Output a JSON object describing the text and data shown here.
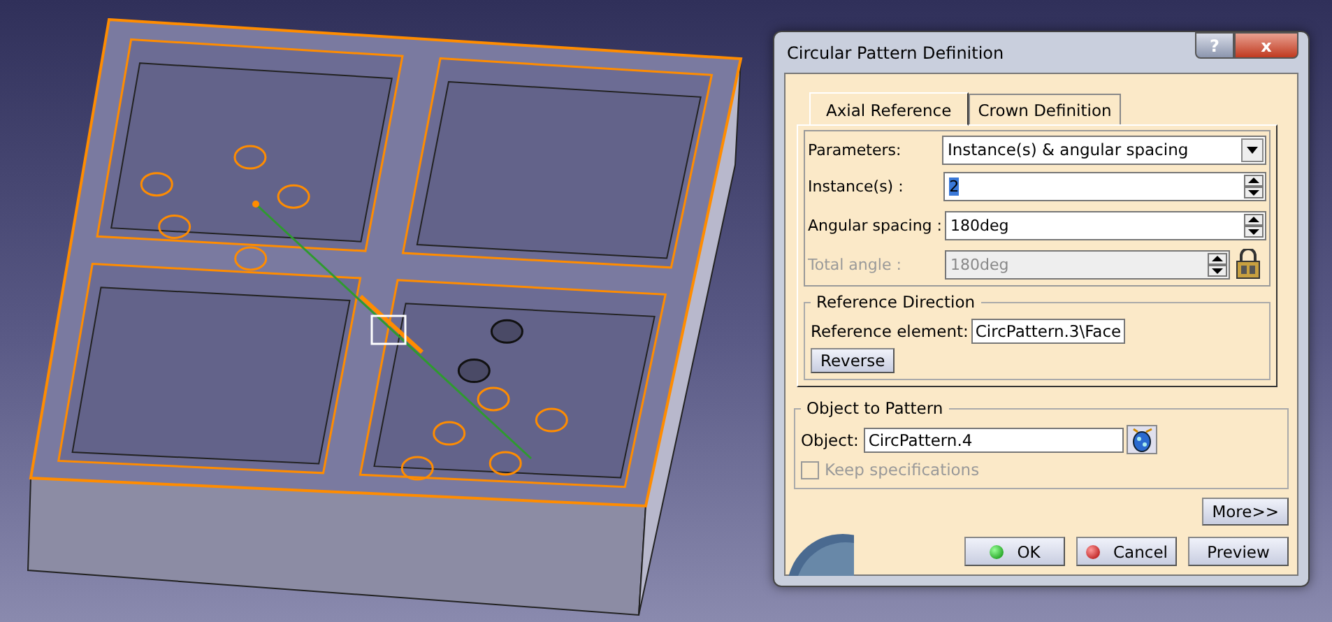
{
  "dialog": {
    "title": "Circular Pattern Definition",
    "help": "?",
    "close": "x"
  },
  "tabs": [
    {
      "label": "Axial Reference",
      "selected": true
    },
    {
      "label": "Crown Definition",
      "selected": false
    }
  ],
  "parameters": [
    {
      "kind": "select",
      "label": "Parameters:",
      "value": "Instance(s) & angular spacing"
    },
    {
      "kind": "spin",
      "label": "Instance(s) :",
      "value": "2",
      "disabled": false,
      "highlighted": true
    },
    {
      "kind": "spin",
      "label": "Angular spacing :",
      "value": "180deg",
      "disabled": false,
      "highlighted": false
    },
    {
      "kind": "spin",
      "label": "Total angle :",
      "value": "180deg",
      "disabled": true,
      "highlighted": false
    }
  ],
  "reference_direction": {
    "title": "Reference Direction",
    "label": "Reference element:",
    "value": "CircPattern.3\\Face",
    "button": "Reverse"
  },
  "object_to_pattern": {
    "title": "Object to Pattern",
    "label": "Object:",
    "value": "CircPattern.4",
    "keep_specifications": {
      "label": "Keep specifications",
      "checked": false,
      "disabled": true
    }
  },
  "more_button": "More>>",
  "buttons": [
    {
      "kind": "ok",
      "label": "OK"
    },
    {
      "kind": "cancel",
      "label": "Cancel"
    },
    {
      "kind": "plain",
      "label": "Preview"
    }
  ]
}
